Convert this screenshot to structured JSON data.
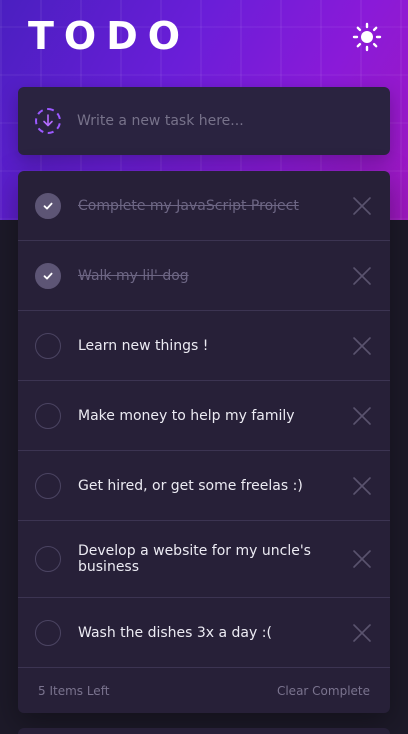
{
  "app": {
    "title": "TODO"
  },
  "header": {
    "theme_icon": "sun-icon"
  },
  "new_task": {
    "placeholder": "Write a new task here...",
    "value": ""
  },
  "tasks": [
    {
      "text": "Complete my JavaScript Project",
      "completed": true
    },
    {
      "text": "Walk my lil' dog",
      "completed": true
    },
    {
      "text": "Learn new things !",
      "completed": false
    },
    {
      "text": "Make money to help my family",
      "completed": false
    },
    {
      "text": "Get hired, or get some freelas :)",
      "completed": false
    },
    {
      "text": "Develop a website for my uncle's business",
      "completed": false
    },
    {
      "text": "Wash the dishes 3x a day :(",
      "completed": false
    }
  ],
  "footer": {
    "items_left": "5 Items Left",
    "clear_label": "Clear Complete"
  },
  "colors": {
    "accent_start": "#4a1fc0",
    "accent_end": "#a018c0",
    "card_bg": "#272038",
    "page_bg": "#1d1a29"
  }
}
